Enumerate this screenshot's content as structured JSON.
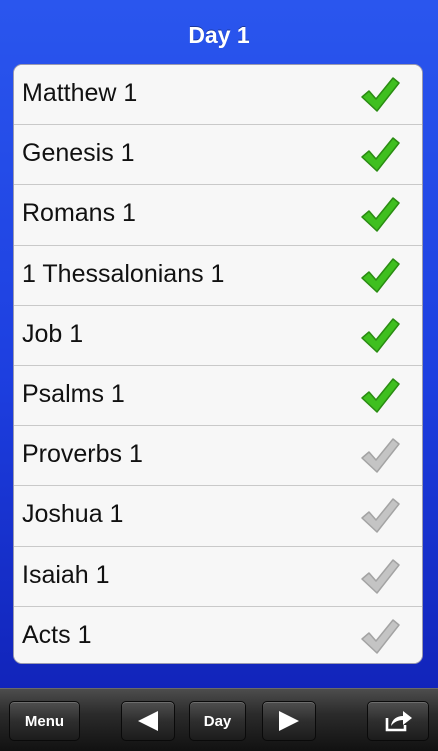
{
  "header": {
    "title": "Day 1"
  },
  "readings": [
    {
      "label": "Matthew 1",
      "status": "complete",
      "icon": "checkmark-green-icon"
    },
    {
      "label": "Genesis 1",
      "status": "complete",
      "icon": "checkmark-green-icon"
    },
    {
      "label": "Romans 1",
      "status": "complete",
      "icon": "checkmark-green-icon"
    },
    {
      "label": "1 Thessalonians 1",
      "status": "complete",
      "icon": "checkmark-green-icon"
    },
    {
      "label": "Job 1",
      "status": "complete",
      "icon": "checkmark-green-icon"
    },
    {
      "label": "Psalms 1",
      "status": "complete",
      "icon": "checkmark-green-icon"
    },
    {
      "label": "Proverbs 1",
      "status": "incomplete",
      "icon": "checkmark-gray-icon"
    },
    {
      "label": "Joshua 1",
      "status": "incomplete",
      "icon": "checkmark-gray-icon"
    },
    {
      "label": "Isaiah 1",
      "status": "incomplete",
      "icon": "checkmark-gray-icon"
    },
    {
      "label": "Acts 1",
      "status": "incomplete",
      "icon": "checkmark-gray-icon"
    }
  ],
  "toolbar": {
    "menu_label": "Menu",
    "prev_icon": "arrow-left-icon",
    "day_label": "Day",
    "next_icon": "arrow-right-icon",
    "share_icon": "share-icon"
  },
  "colors": {
    "background_top": "#2a56ee",
    "background_bottom": "#0f1fb3",
    "check_complete": "#3fbf1f",
    "check_incomplete": "#c4c4c4"
  }
}
